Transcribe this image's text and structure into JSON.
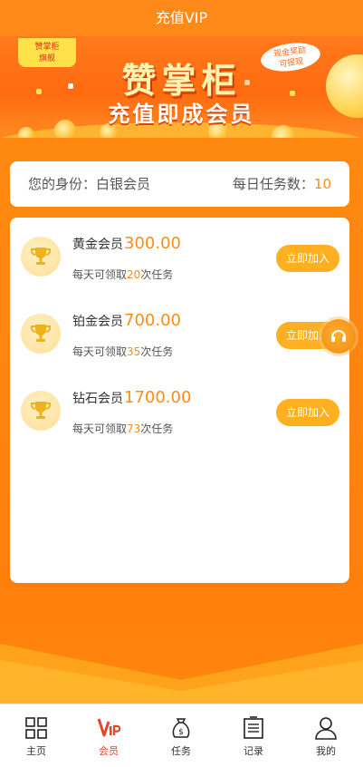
{
  "header": {
    "title": "充值VIP"
  },
  "banner": {
    "tag_line1": "赞掌柜",
    "tag_line2": "旗舰",
    "bubble_line1": "现金奖励",
    "bubble_line2": "可提现",
    "title": "赞掌柜",
    "subtitle": "充值即成会员"
  },
  "identity": {
    "label": "您的身份：白银会员",
    "daily_label": "每日任务数：",
    "daily_count": "10"
  },
  "tiers": [
    {
      "name": "黄金会员",
      "price": "300.00",
      "desc_pre": "每天可领取",
      "tasks": "20",
      "desc_post": "次任务",
      "button": "立即加入"
    },
    {
      "name": "铂金会员",
      "price": "700.00",
      "desc_pre": "每天可领取",
      "tasks": "35",
      "desc_post": "次任务",
      "button": "立即加入"
    },
    {
      "name": "钻石会员",
      "price": "1700.00",
      "desc_pre": "每天可领取",
      "tasks": "73",
      "desc_post": "次任务",
      "button": "立即加入"
    }
  ],
  "tabbar": {
    "items": [
      {
        "label": "主页",
        "icon": "grid-icon"
      },
      {
        "label": "会员",
        "icon": "vip-icon"
      },
      {
        "label": "任务",
        "icon": "money-bag-icon"
      },
      {
        "label": "记录",
        "icon": "document-icon"
      },
      {
        "label": "我的",
        "icon": "user-icon"
      }
    ],
    "active_index": 1
  },
  "colors": {
    "accent": "#ff8c1a",
    "button": "#ffb020",
    "active_tab": "#e8452a",
    "background": "#ff8710"
  }
}
